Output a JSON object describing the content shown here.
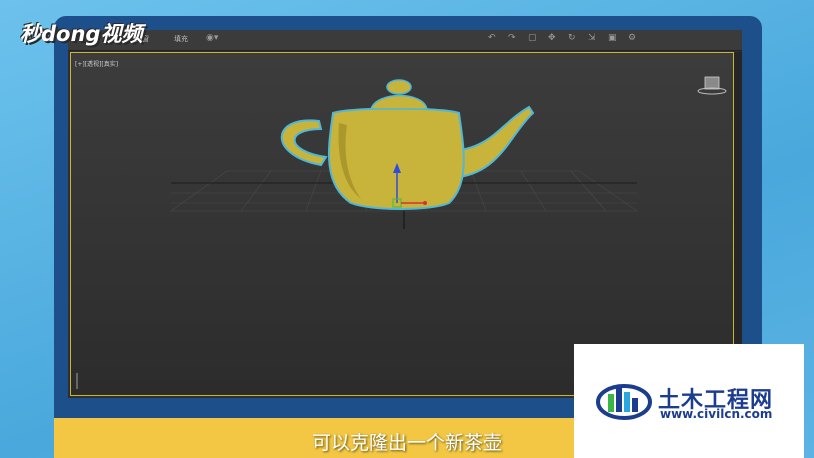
{
  "brand": {
    "logo_text": "秒dong视频"
  },
  "menubar": {
    "items": [
      "视图窗",
      "填充"
    ],
    "icons": [
      "undo-icon",
      "redo-icon",
      "select-icon",
      "move-icon",
      "rotate-icon",
      "scale-icon",
      "render-icon"
    ]
  },
  "viewport": {
    "label": "[+][透视][真实]",
    "object": "teapot",
    "object_color": "#c8b43a",
    "selection_outline_color": "#4fb7d8"
  },
  "caption": {
    "text": "可以克隆出一个新茶壶"
  },
  "watermark": {
    "title": "土木工程网",
    "url": "www.civilcn.com"
  }
}
